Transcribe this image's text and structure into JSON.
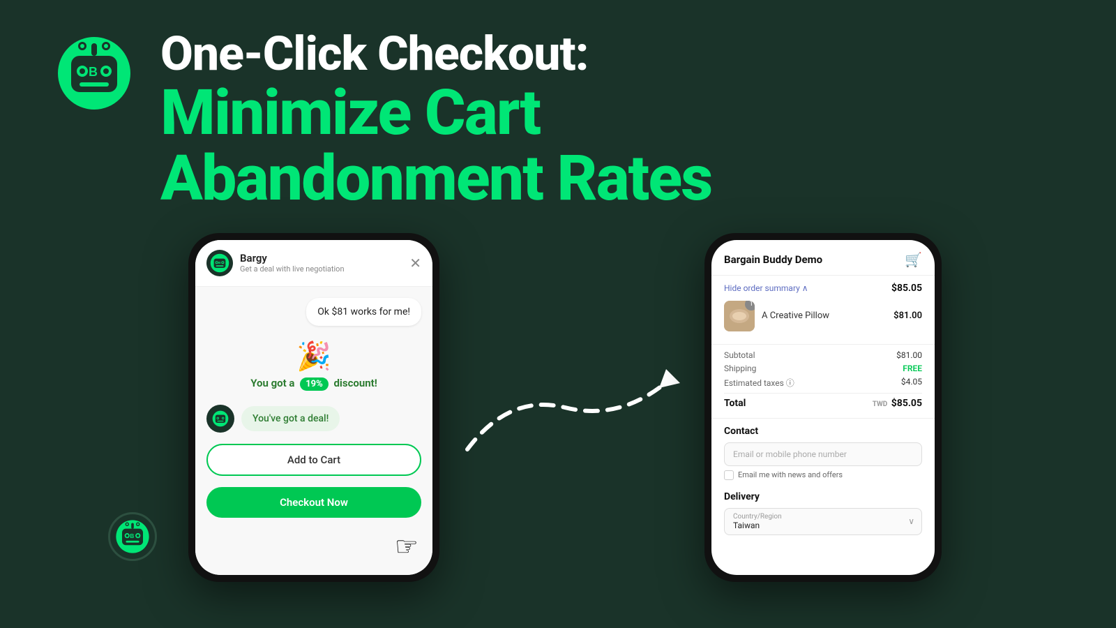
{
  "brand": {
    "name": "Bargy",
    "logo_alt": "Bargy logo robot"
  },
  "headline": {
    "line1": "One-Click Checkout:",
    "line2": "Minimize Cart",
    "line3": "Abandonment Rates"
  },
  "left_phone": {
    "chat_name": "Bargy",
    "chat_subtitle": "Get a deal with live negotiation",
    "close_btn": "✕",
    "message": "Ok $81 works for me!",
    "discount_text_before": "You got a",
    "discount_badge": "19%",
    "discount_text_after": "discount!",
    "deal_message": "You've got a deal!",
    "add_to_cart_btn": "Add to Cart",
    "checkout_btn": "Checkout Now"
  },
  "right_phone": {
    "store_name": "Bargain Buddy Demo",
    "hide_summary": "Hide order summary",
    "header_total": "$85.05",
    "product_name": "A Creative Pillow",
    "product_price": "$81.00",
    "product_qty": "1",
    "subtotal_label": "Subtotal",
    "subtotal_value": "$81.00",
    "shipping_label": "Shipping",
    "shipping_value": "FREE",
    "taxes_label": "Estimated taxes",
    "taxes_value": "$4.05",
    "total_label": "Total",
    "total_currency": "TWD",
    "total_value": "$85.05",
    "contact_title": "Contact",
    "contact_placeholder": "Email or mobile phone number",
    "newsletter_label": "Email me with news and offers",
    "delivery_title": "Delivery",
    "country_label": "Country/Region",
    "country_value": "Taiwan"
  },
  "colors": {
    "background": "#1a3329",
    "green_accent": "#00e676",
    "green_button": "#00c853",
    "white": "#ffffff"
  }
}
